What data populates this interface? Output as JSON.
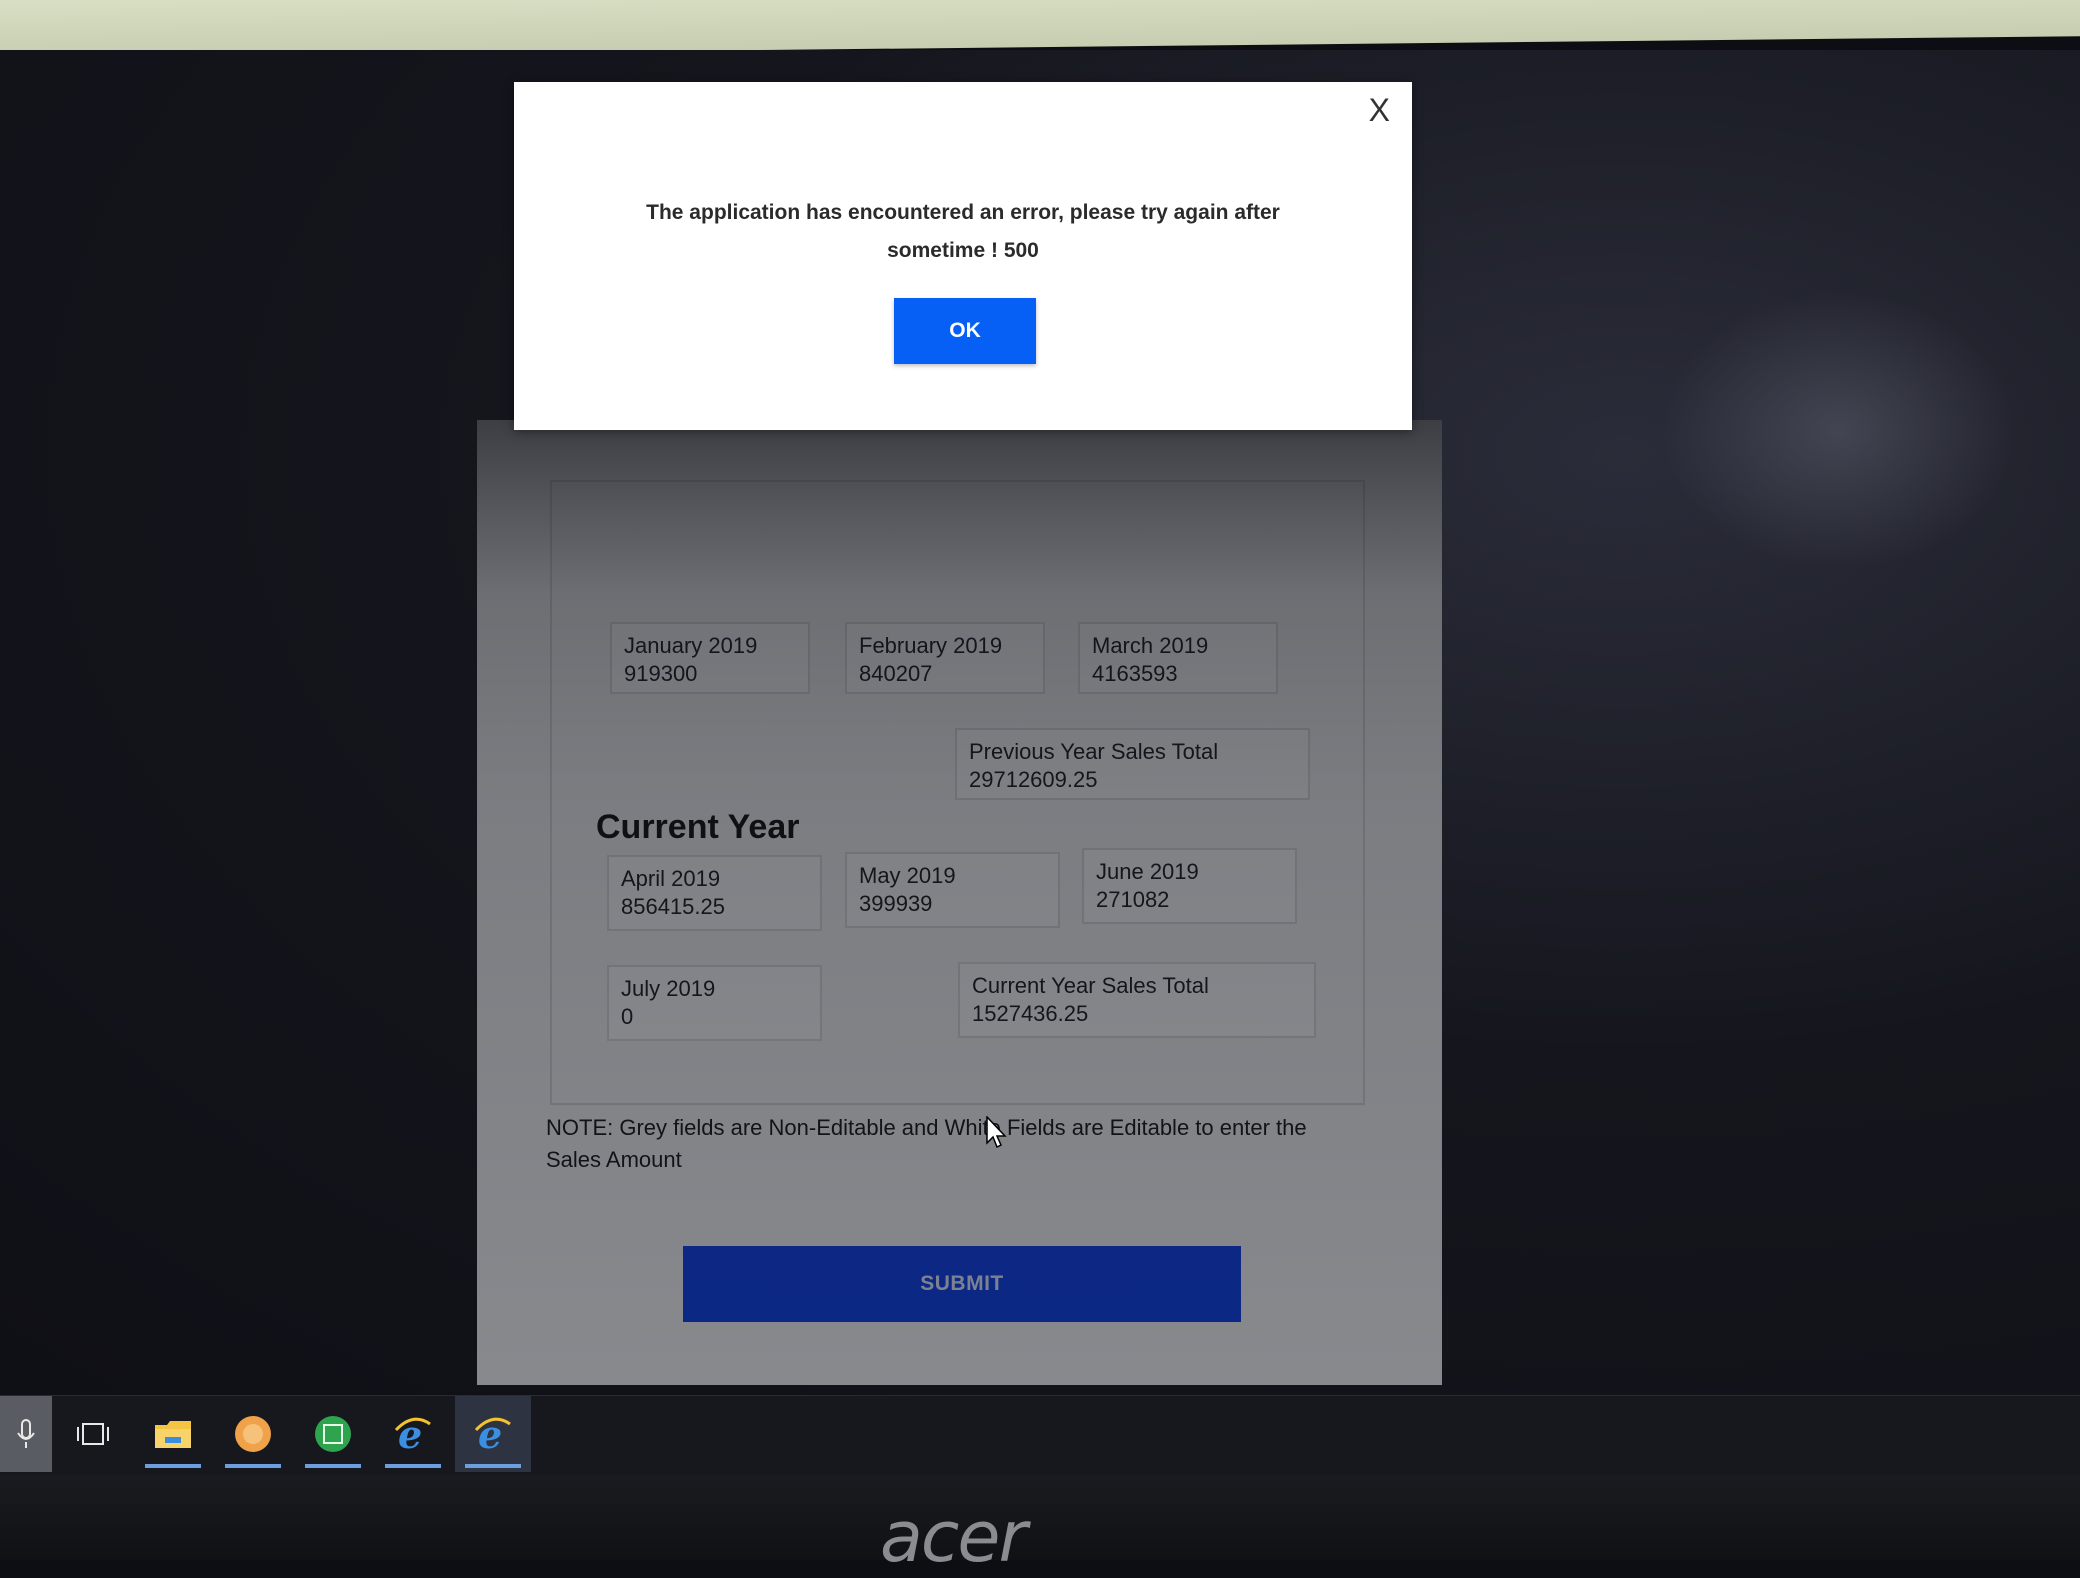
{
  "modal": {
    "close_label": "X",
    "message": "The application has encountered an error, please try again after sometime ! 500",
    "ok_label": "OK"
  },
  "previous_year": {
    "months": [
      {
        "label": "January 2019",
        "value": "919300"
      },
      {
        "label": "February 2019",
        "value": "840207"
      },
      {
        "label": "March 2019",
        "value": "4163593"
      }
    ],
    "total": {
      "label": "Previous Year Sales Total",
      "value": "29712609.25"
    }
  },
  "current_year": {
    "title": "Current Year",
    "months": [
      {
        "label": "April 2019",
        "value": "856415.25"
      },
      {
        "label": "May 2019",
        "value": "399939"
      },
      {
        "label": "June 2019",
        "value": "271082"
      },
      {
        "label": "July 2019",
        "value": "0"
      }
    ],
    "total": {
      "label": "Current Year Sales Total",
      "value": "1527436.25"
    }
  },
  "note": "NOTE: Grey fields are Non-Editable and White Fields are Editable to enter the Sales Amount",
  "submit_label": "SUBMIT",
  "taskbar": {
    "items": [
      {
        "name": "microphone-icon"
      },
      {
        "name": "task-view-icon"
      },
      {
        "name": "file-explorer-icon"
      },
      {
        "name": "app-orange-icon"
      },
      {
        "name": "app-green-icon"
      },
      {
        "name": "internet-explorer-icon"
      },
      {
        "name": "internet-explorer-active-icon"
      }
    ]
  },
  "brand": "acer"
}
